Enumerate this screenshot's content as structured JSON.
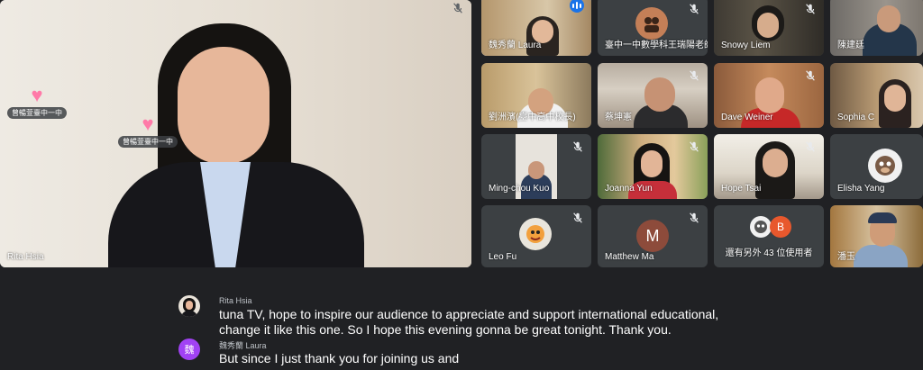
{
  "main_speaker": {
    "name": "Rita Hsia",
    "reactions": [
      {
        "emoji": "♥",
        "label": "曾暢萱臺中一中"
      },
      {
        "emoji": "♥",
        "label": "曾暢萱臺中一中"
      }
    ]
  },
  "participants": [
    {
      "name": "魏秀蘭 Laura",
      "status": "speaking"
    },
    {
      "name": "臺中一中數學科王瑞陽老師",
      "status": "muted"
    },
    {
      "name": "Snowy Liem",
      "status": "muted"
    },
    {
      "name": "陳建廷",
      "status": "muted"
    },
    {
      "name": "劉洲濱(臺中高中校長)",
      "status": "muted"
    },
    {
      "name": "蔡坤憲",
      "status": "muted"
    },
    {
      "name": "Dave Weiner",
      "status": "muted"
    },
    {
      "name": "Sophia C",
      "status": "muted"
    },
    {
      "name": "Ming-chou Kuo",
      "status": "muted"
    },
    {
      "name": "Joanna Yun",
      "status": "muted"
    },
    {
      "name": "Hope Tsai",
      "status": "muted"
    },
    {
      "name": "Elisha Yang",
      "status": "muted"
    },
    {
      "name": "Leo Fu",
      "status": "muted"
    },
    {
      "name": "Matthew Ma",
      "status": "muted",
      "initial": "M"
    },
    {
      "name": "還有另外 43 位使用者",
      "initial": "B"
    },
    {
      "name": "潘玉"
    }
  ],
  "captions": [
    {
      "speaker": "Rita Hsia",
      "text": "tuna TV, hope to inspire our audience to appreciate and support international educational, change it like this one. So I hope this evening gonna be great tonight. Thank you."
    },
    {
      "speaker": "魏秀蘭 Laura",
      "avatar_initial": "魏",
      "text": "But since I just thank you for joining us and"
    }
  ],
  "colors": {
    "background": "#202124",
    "tile": "#3c4043",
    "active_speaker": "#8ab4f8",
    "speaking_badge": "#1a73e8",
    "matthew_avatar": "#8d4b3b",
    "b_avatar": "#e8582d",
    "laura_avatar": "#a142f4"
  }
}
